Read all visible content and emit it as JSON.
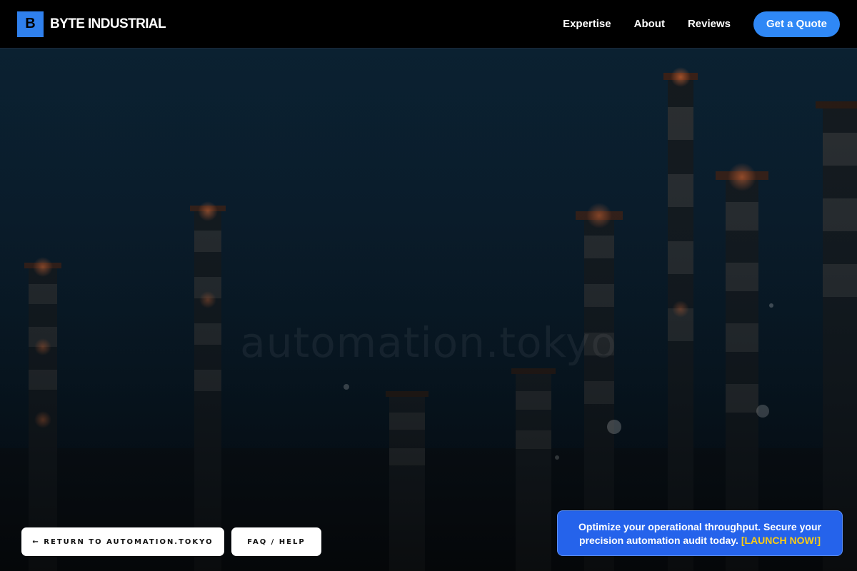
{
  "header": {
    "logo_letter": "B",
    "brand_name": "BYTE INDUSTRIAL",
    "nav": [
      {
        "label": "Expertise"
      },
      {
        "label": "About"
      },
      {
        "label": "Reviews"
      }
    ],
    "cta_label": "Get a Quote"
  },
  "hero": {
    "watermark": "automation.tokyo"
  },
  "actions": {
    "return_label": "← RETURN TO AUTOMATION.TOKYO",
    "faq_label": "FAQ / HELP"
  },
  "promo": {
    "text": "Optimize your operational throughput. Secure your precision automation audit today.",
    "link_label": "[LAUNCH NOW!]"
  },
  "colors": {
    "accent": "#2f88f6",
    "promo_bg": "#2563eb",
    "promo_link": "#facc15",
    "header_bg": "#000000"
  },
  "icons": {
    "return_arrow": "left-arrow-icon"
  }
}
